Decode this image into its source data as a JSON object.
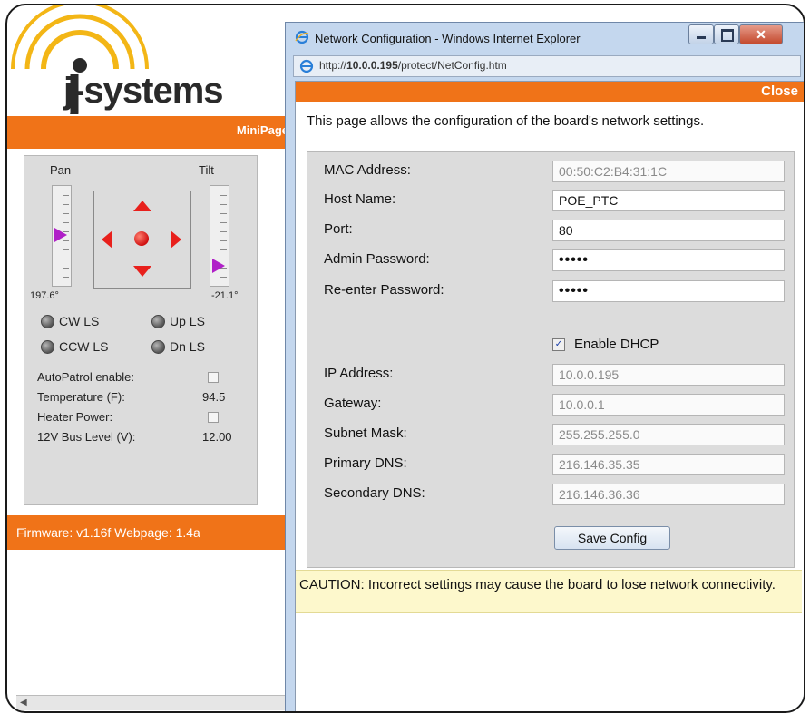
{
  "background": {
    "logo_text": "j-systems",
    "nav_label": "MiniPage",
    "pan": {
      "label": "Pan",
      "value": "197.6°"
    },
    "tilt": {
      "label": "Tilt",
      "value": "-21.1°"
    },
    "limit_switches": [
      "CW LS",
      "Up LS",
      "CCW LS",
      "Dn LS"
    ],
    "info": [
      {
        "label": "AutoPatrol enable:",
        "value": ""
      },
      {
        "label": "Temperature (F):",
        "value": "94.5"
      },
      {
        "label": "Heater Power:",
        "value": ""
      },
      {
        "label": "12V Bus Level (V):",
        "value": "12.00"
      }
    ],
    "firmware_text": "Firmware: v1.16f  Webpage: 1.4a"
  },
  "popup": {
    "title": "Network Configuration - Windows Internet Explorer",
    "url_prefix": "http://",
    "url_host": "10.0.0.195",
    "url_path": "/protect/NetConfig.htm",
    "close_label": "Close",
    "intro": "This page allows the configuration of the board's network settings.",
    "fields": {
      "mac": {
        "label": "MAC Address:",
        "value": "00:50:C2:B4:31:1C"
      },
      "host": {
        "label": "Host Name:",
        "value": "POE_PTC"
      },
      "port": {
        "label": "Port:",
        "value": "80"
      },
      "admin_pw": {
        "label": "Admin Password:",
        "value": "•••••"
      },
      "reenter_pw": {
        "label": "Re-enter Password:",
        "value": "•••••"
      },
      "ip": {
        "label": "IP Address:",
        "value": "10.0.0.195"
      },
      "gateway": {
        "label": "Gateway:",
        "value": "10.0.0.1"
      },
      "subnet": {
        "label": "Subnet Mask:",
        "value": "255.255.255.0"
      },
      "dns1": {
        "label": "Primary DNS:",
        "value": "216.146.35.35"
      },
      "dns2": {
        "label": "Secondary DNS:",
        "value": "216.146.36.36"
      }
    },
    "dhcp_label": "Enable DHCP",
    "dhcp_checked": true,
    "save_label": "Save Config",
    "caution": "CAUTION: Incorrect settings may cause the board to lose network connectivity."
  },
  "colors": {
    "accent": "#f07318",
    "panel": "#dcdcdc",
    "arrow": "#e8201c",
    "slider_marker": "#b020c8"
  }
}
